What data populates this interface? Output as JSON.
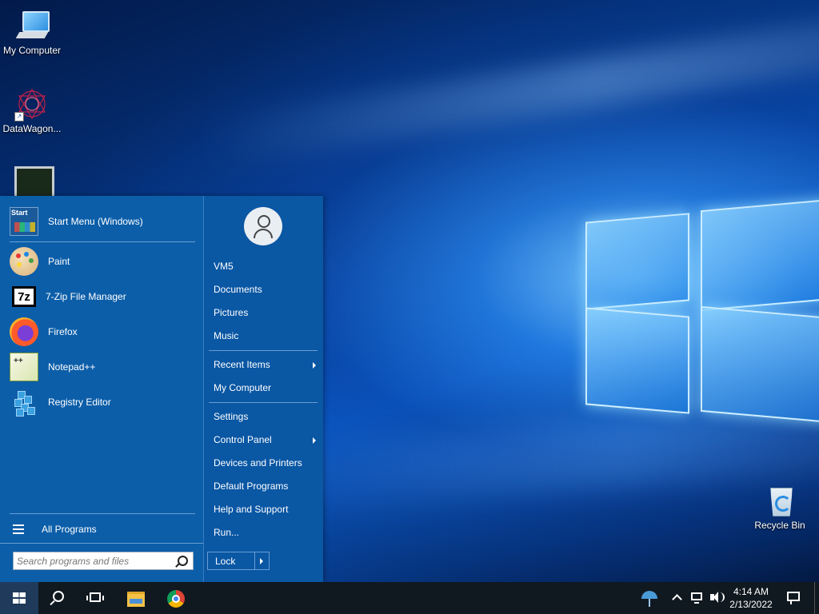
{
  "desktop": {
    "icons": [
      {
        "label": "My Computer",
        "icon": "my-computer-icon"
      },
      {
        "label": "DataWagon...",
        "icon": "datawagon-icon"
      },
      {
        "label": "",
        "icon": "monitor-app-icon"
      },
      {
        "label": "Recycle Bin",
        "icon": "recycle-bin-icon"
      }
    ]
  },
  "start_menu": {
    "pinned": {
      "label": "Start Menu (Windows)",
      "icon_text": "Start"
    },
    "programs": [
      {
        "label": "Paint",
        "icon": "paint-icon"
      },
      {
        "label": "7-Zip File Manager",
        "icon": "7zip-icon",
        "icon_text": "7z"
      },
      {
        "label": "Firefox",
        "icon": "firefox-icon"
      },
      {
        "label": "Notepad++",
        "icon": "notepad-plus-plus-icon"
      },
      {
        "label": "Registry Editor",
        "icon": "registry-editor-icon"
      }
    ],
    "all_programs": "All Programs",
    "search": {
      "placeholder": "Search programs and files",
      "value": ""
    },
    "right": {
      "user": "VM5",
      "documents": "Documents",
      "pictures": "Pictures",
      "music": "Music",
      "recent_items": "Recent Items",
      "my_computer": "My Computer",
      "settings": "Settings",
      "control_panel": "Control Panel",
      "devices_printers": "Devices and Printers",
      "default_programs": "Default Programs",
      "help_support": "Help and Support",
      "run": "Run...",
      "lock": "Lock"
    }
  },
  "taskbar": {
    "time": "4:14 AM",
    "date": "2/13/2022"
  },
  "colors": {
    "start_menu_bg": "#0c5ea9",
    "taskbar_bg": "#101820",
    "start_button_bg": "#1f3a5a"
  }
}
